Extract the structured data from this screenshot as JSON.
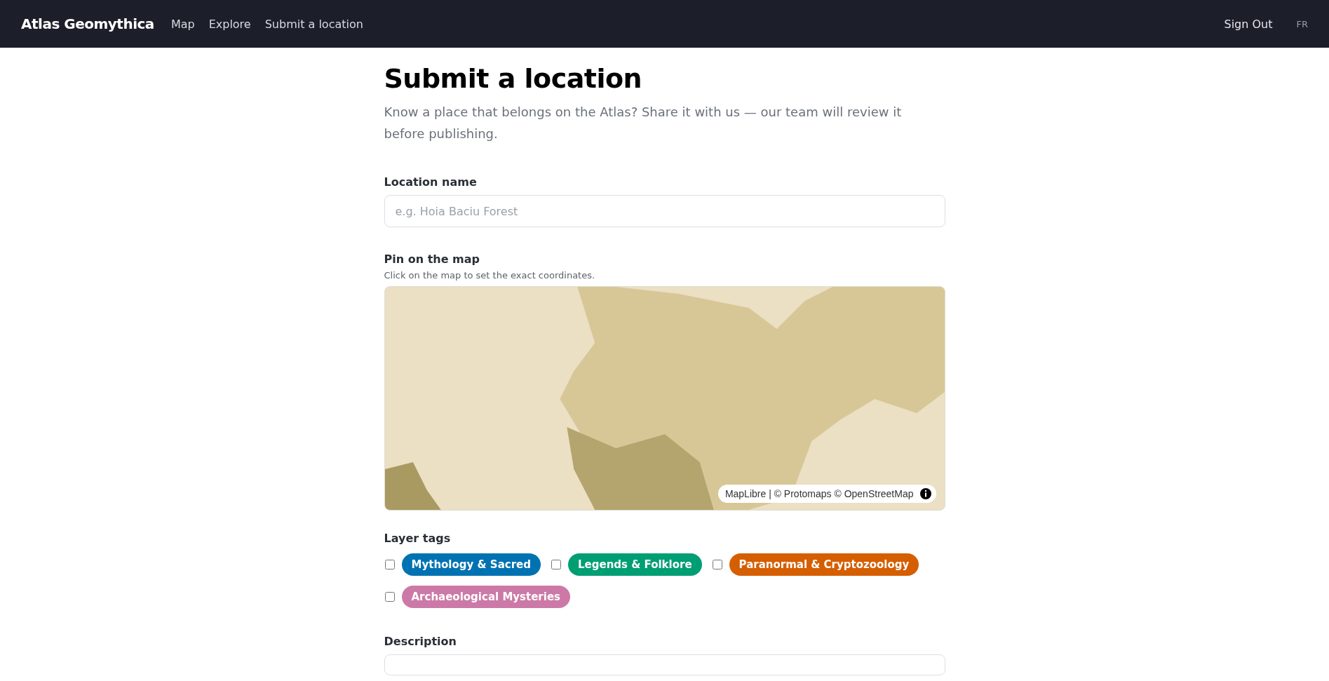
{
  "nav": {
    "brand": "Atlas Geomythica",
    "links": [
      {
        "label": "Map"
      },
      {
        "label": "Explore"
      },
      {
        "label": "Submit a location"
      }
    ],
    "sign_out": "Sign Out",
    "language": "FR"
  },
  "page": {
    "title": "Submit a location",
    "subtitle": "Know a place that belongs on the Atlas? Share it with us — our team will review it before publishing."
  },
  "location_name": {
    "label": "Location name",
    "placeholder": "e.g. Hoia Baciu Forest"
  },
  "map": {
    "label": "Pin on the map",
    "hint": "Click on the map to set the exact coordinates.",
    "attribution": "MapLibre | © Protomaps © OpenStreetMap"
  },
  "layer_tags": {
    "label": "Layer tags",
    "tags": [
      {
        "label": "Mythology & Sacred",
        "checked": false,
        "color": "#0072b2"
      },
      {
        "label": "Legends & Folklore",
        "checked": false,
        "color": "#009e73"
      },
      {
        "label": "Paranormal & Cryptozoology",
        "checked": false,
        "color": "#d55e00"
      },
      {
        "label": "Archaeological Mysteries",
        "checked": false,
        "color": "#cc79a7"
      }
    ]
  },
  "description": {
    "label": "Description"
  }
}
